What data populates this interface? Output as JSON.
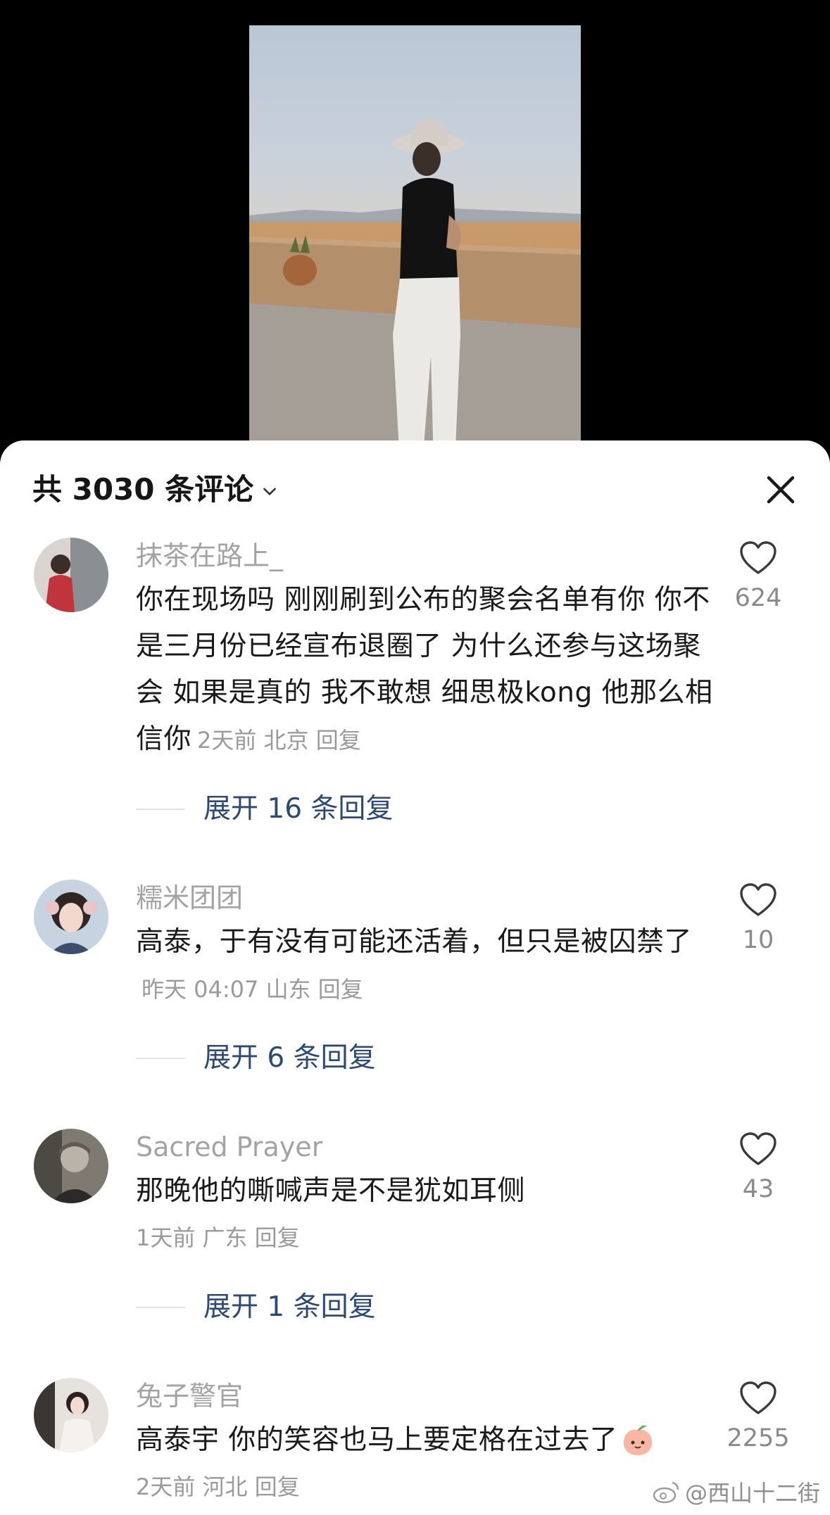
{
  "header": {
    "comment_count": "共 3030 条评论"
  },
  "comments": [
    {
      "username": "抹茶在路上_",
      "text": "你在现场吗 刚刚刷到公布的聚会名单有你 你不是三月份已经宣布退圈了 为什么还参与这场聚会 如果是真的 我不敢想 细思极kong 他那么相信你",
      "meta": "2天前 北京 回复",
      "likes": "624",
      "expand": "展开 16 条回复"
    },
    {
      "username": "糯米团团",
      "text": "高泰，于有没有可能还活着，但只是被囚禁了",
      "meta": "昨天 04:07 山东 回复",
      "likes": "10",
      "expand": "展开 6 条回复"
    },
    {
      "username": "Sacred Prayer",
      "text": "那晚他的嘶喊声是不是犹如耳侧",
      "meta": "1天前 广东 回复",
      "likes": "43",
      "expand": "展开 1 条回复"
    },
    {
      "username": "兔子警官",
      "text": "高泰宇 你的笑容也马上要定格在过去了",
      "meta": "2天前 河北 回复",
      "likes": "2255"
    }
  ],
  "watermark": "@西山十二街",
  "icons": {
    "close": "close-icon",
    "chevron": "chevron-down-icon",
    "like": "heart-outline-icon",
    "emoji": "peach-emoji-icon",
    "watermark": "weibo-logo-icon"
  }
}
